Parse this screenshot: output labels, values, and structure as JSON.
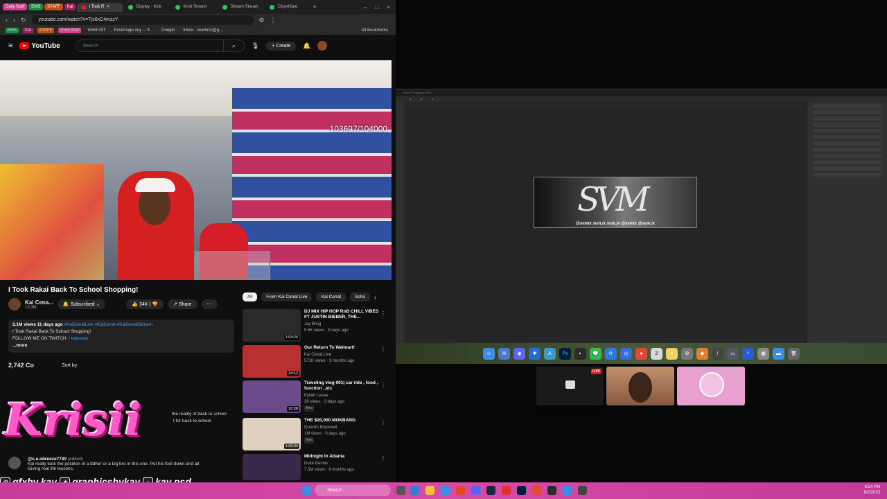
{
  "browser": {
    "tab_groups": [
      {
        "label": "Daily Stuff",
        "color": "#d0408a"
      },
      {
        "label": "EMS",
        "color": "#1f8a4a"
      },
      {
        "label": "STAFF",
        "color": "#c05010"
      },
      {
        "label": "Kai",
        "color": "#a02060"
      }
    ],
    "tabs": [
      "I Took R",
      "Display - Kick",
      "Krisii Stream",
      "Stream Stream",
      "Clips4Sale"
    ],
    "url": "youtube.com/watch?v=Tjs0xC4mzzY",
    "bookmarks": [
      "EMS",
      "Kai",
      "STAFF",
      "Daily Stuff",
      "WSHUST",
      "Postimage.org — fr...",
      "Google",
      "Inbox - rewrkrisi@g...",
      "All Bookmarks"
    ]
  },
  "youtube": {
    "logo": "YouTube",
    "search_placeholder": "Search",
    "create": "Create",
    "video": {
      "counter": "103697/104000",
      "title": "I Took Rakai Back To School Shopping!",
      "channel": "Kai Cena...",
      "subs": "13.3M",
      "subscribed": "Subscribed",
      "likes": "34K",
      "share": "Share",
      "stats": "2.1M views  11 days ago",
      "hashtags": "#KaiCenatLive #KaiCenat #KaiCenatStream",
      "desc_line1": "I Took Rakai Back To School Shopping!",
      "desc_line2": "FOLLOW ME ON TWITCH:",
      "twitch_link": "/ kaicenat",
      "more": "...more"
    },
    "comments": {
      "count": "2,742 Co",
      "sort": "Sort by",
      "c1_frag": "the reality of back to school",
      "c1_frag2": "t for back to school",
      "c2_user": "@c.e.obreeze7730",
      "c2_edited": "(edited)",
      "c2_text": "Kai really took the position of a father or a big bro in this one. Put his foot down and all.",
      "c2_text2": "Giving real life lessons."
    },
    "chips": [
      "All",
      "From Kai Cenat Live",
      "Kai Cenat",
      "Scho"
    ],
    "recommendations": [
      {
        "title": "DJ MIX HIP HOP RnB CHILL VIBES FT JUSTIN BIEBER, THE...",
        "channel": "Jay Bling",
        "meta": "9.6K views · 8 days ago",
        "duration": "1:04:24",
        "color": "#2a2a2a"
      },
      {
        "title": "Our Return To Walmart!",
        "channel": "Kai Cenat Live",
        "meta": "571K views · 3 months ago",
        "duration": "34:12",
        "color": "#b83030"
      },
      {
        "title": "Traveling vlog 001| car ride , food , function ..etc",
        "channel": "Kyliah Levae",
        "meta": "36 views · 3 days ago",
        "duration": "10:28",
        "badge": "New",
        "color": "#6a4a8a"
      },
      {
        "title": "THE $20,000 MUKBANG",
        "channel": "Quenlin Blackwell",
        "meta": "1M views · 6 days ago",
        "duration": "1:09:04",
        "badge": "New",
        "color": "#e0d0c0"
      },
      {
        "title": "Midnight In Atlanta",
        "channel": "Duke Dennis",
        "meta": "7.3M views · 9 months ago",
        "duration": "",
        "color": "#3a2a4a"
      }
    ]
  },
  "photoshop": {
    "title": "Adobe Photoshop 2023",
    "banner_big": "SVM",
    "banner_footer": "@svmix  svm.ix  svm.ix  @svmix  @svm.ix"
  },
  "stream": {
    "live": "LIVE",
    "watermark": "Krisii",
    "handles": [
      "gfxby.kay",
      "graphicsbykay",
      "kay.psd"
    ]
  },
  "taskbar": {
    "search": "Search",
    "time": "6:54 PM",
    "date": "8/2/2023"
  },
  "colors": {
    "accent": "#ff0000",
    "taskbar": "#d84aa8",
    "watermark": "#ff5bc8"
  }
}
